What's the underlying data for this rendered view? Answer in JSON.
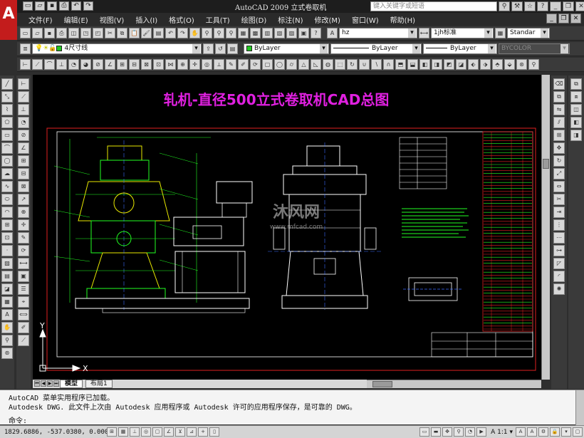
{
  "window": {
    "title": "AutoCAD 2009  立式卷取机",
    "search_placeholder": "键入关键字或短语"
  },
  "menu": [
    "文件(F)",
    "编辑(E)",
    "视图(V)",
    "插入(I)",
    "格式(O)",
    "工具(T)",
    "绘图(D)",
    "标注(N)",
    "修改(M)",
    "窗口(W)",
    "帮助(H)"
  ],
  "styles": {
    "text_style": "hz",
    "dim_style": "1jh标准",
    "table_style": "Standar"
  },
  "layers": {
    "current_layer": "4尺寸线",
    "color": "ByLayer",
    "linetype": "ByLayer",
    "lineweight": "ByLayer",
    "plot_style": "BYCOLOR"
  },
  "drawing": {
    "title": "轧机-直径500立式卷取机CAD总图",
    "watermark": "沐风网",
    "watermark_url": "www.mfcad.com",
    "ucs_x": "X",
    "ucs_y": "Y"
  },
  "tabs": [
    "模型",
    "布局1"
  ],
  "command_history": [
    "AutoCAD 菜单实用程序已加载。",
    "Autodesk DWG.  此文件上次由 Autodesk 应用程序或 Autodesk 许可的应用程序保存，是可靠的 DWG。"
  ],
  "command_prompt": "命令:",
  "status": {
    "coordinates": "1829.6886, -537.0380, 0.0000",
    "annotation_scale": "1:1"
  },
  "colors": {
    "background": "#000000",
    "drawing_green": "#22ff22",
    "drawing_yellow": "#e8e800",
    "drawing_white": "#ffffff",
    "title_magenta": "#e020e0",
    "frame_red": "#e02020"
  }
}
